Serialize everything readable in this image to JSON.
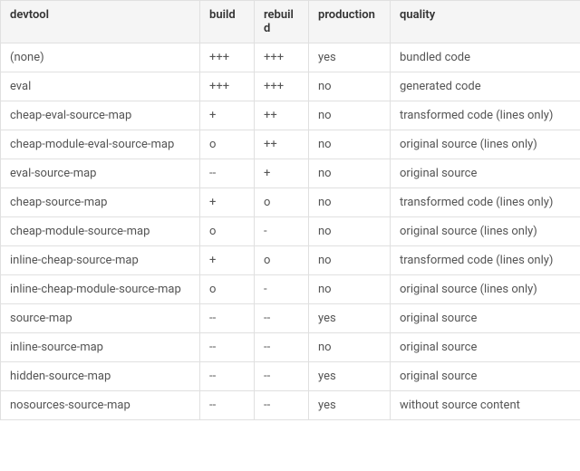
{
  "columns": [
    "devtool",
    "build",
    "rebuild",
    "production",
    "quality"
  ],
  "rows": [
    {
      "devtool": "(none)",
      "build": "+++",
      "rebuild": "+++",
      "production": "yes",
      "quality": "bundled code"
    },
    {
      "devtool": "eval",
      "build": "+++",
      "rebuild": "+++",
      "production": "no",
      "quality": "generated code"
    },
    {
      "devtool": "cheap-eval-source-map",
      "build": "+",
      "rebuild": "++",
      "production": "no",
      "quality": "transformed code (lines only)"
    },
    {
      "devtool": "cheap-module-eval-source-map",
      "build": "o",
      "rebuild": "++",
      "production": "no",
      "quality": "original source (lines only)"
    },
    {
      "devtool": "eval-source-map",
      "build": "--",
      "rebuild": "+",
      "production": "no",
      "quality": "original source"
    },
    {
      "devtool": "cheap-source-map",
      "build": "+",
      "rebuild": "o",
      "production": "no",
      "quality": "transformed code (lines only)"
    },
    {
      "devtool": "cheap-module-source-map",
      "build": "o",
      "rebuild": "-",
      "production": "no",
      "quality": "original source (lines only)"
    },
    {
      "devtool": "inline-cheap-source-map",
      "build": "+",
      "rebuild": "o",
      "production": "no",
      "quality": "transformed code (lines only)"
    },
    {
      "devtool": "inline-cheap-module-source-map",
      "build": "o",
      "rebuild": "-",
      "production": "no",
      "quality": "original source (lines only)"
    },
    {
      "devtool": "source-map",
      "build": "--",
      "rebuild": "--",
      "production": "yes",
      "quality": "original source"
    },
    {
      "devtool": "inline-source-map",
      "build": "--",
      "rebuild": "--",
      "production": "no",
      "quality": "original source"
    },
    {
      "devtool": "hidden-source-map",
      "build": "--",
      "rebuild": "--",
      "production": "yes",
      "quality": "original source"
    },
    {
      "devtool": "nosources-source-map",
      "build": "--",
      "rebuild": "--",
      "production": "yes",
      "quality": "without source content"
    }
  ]
}
